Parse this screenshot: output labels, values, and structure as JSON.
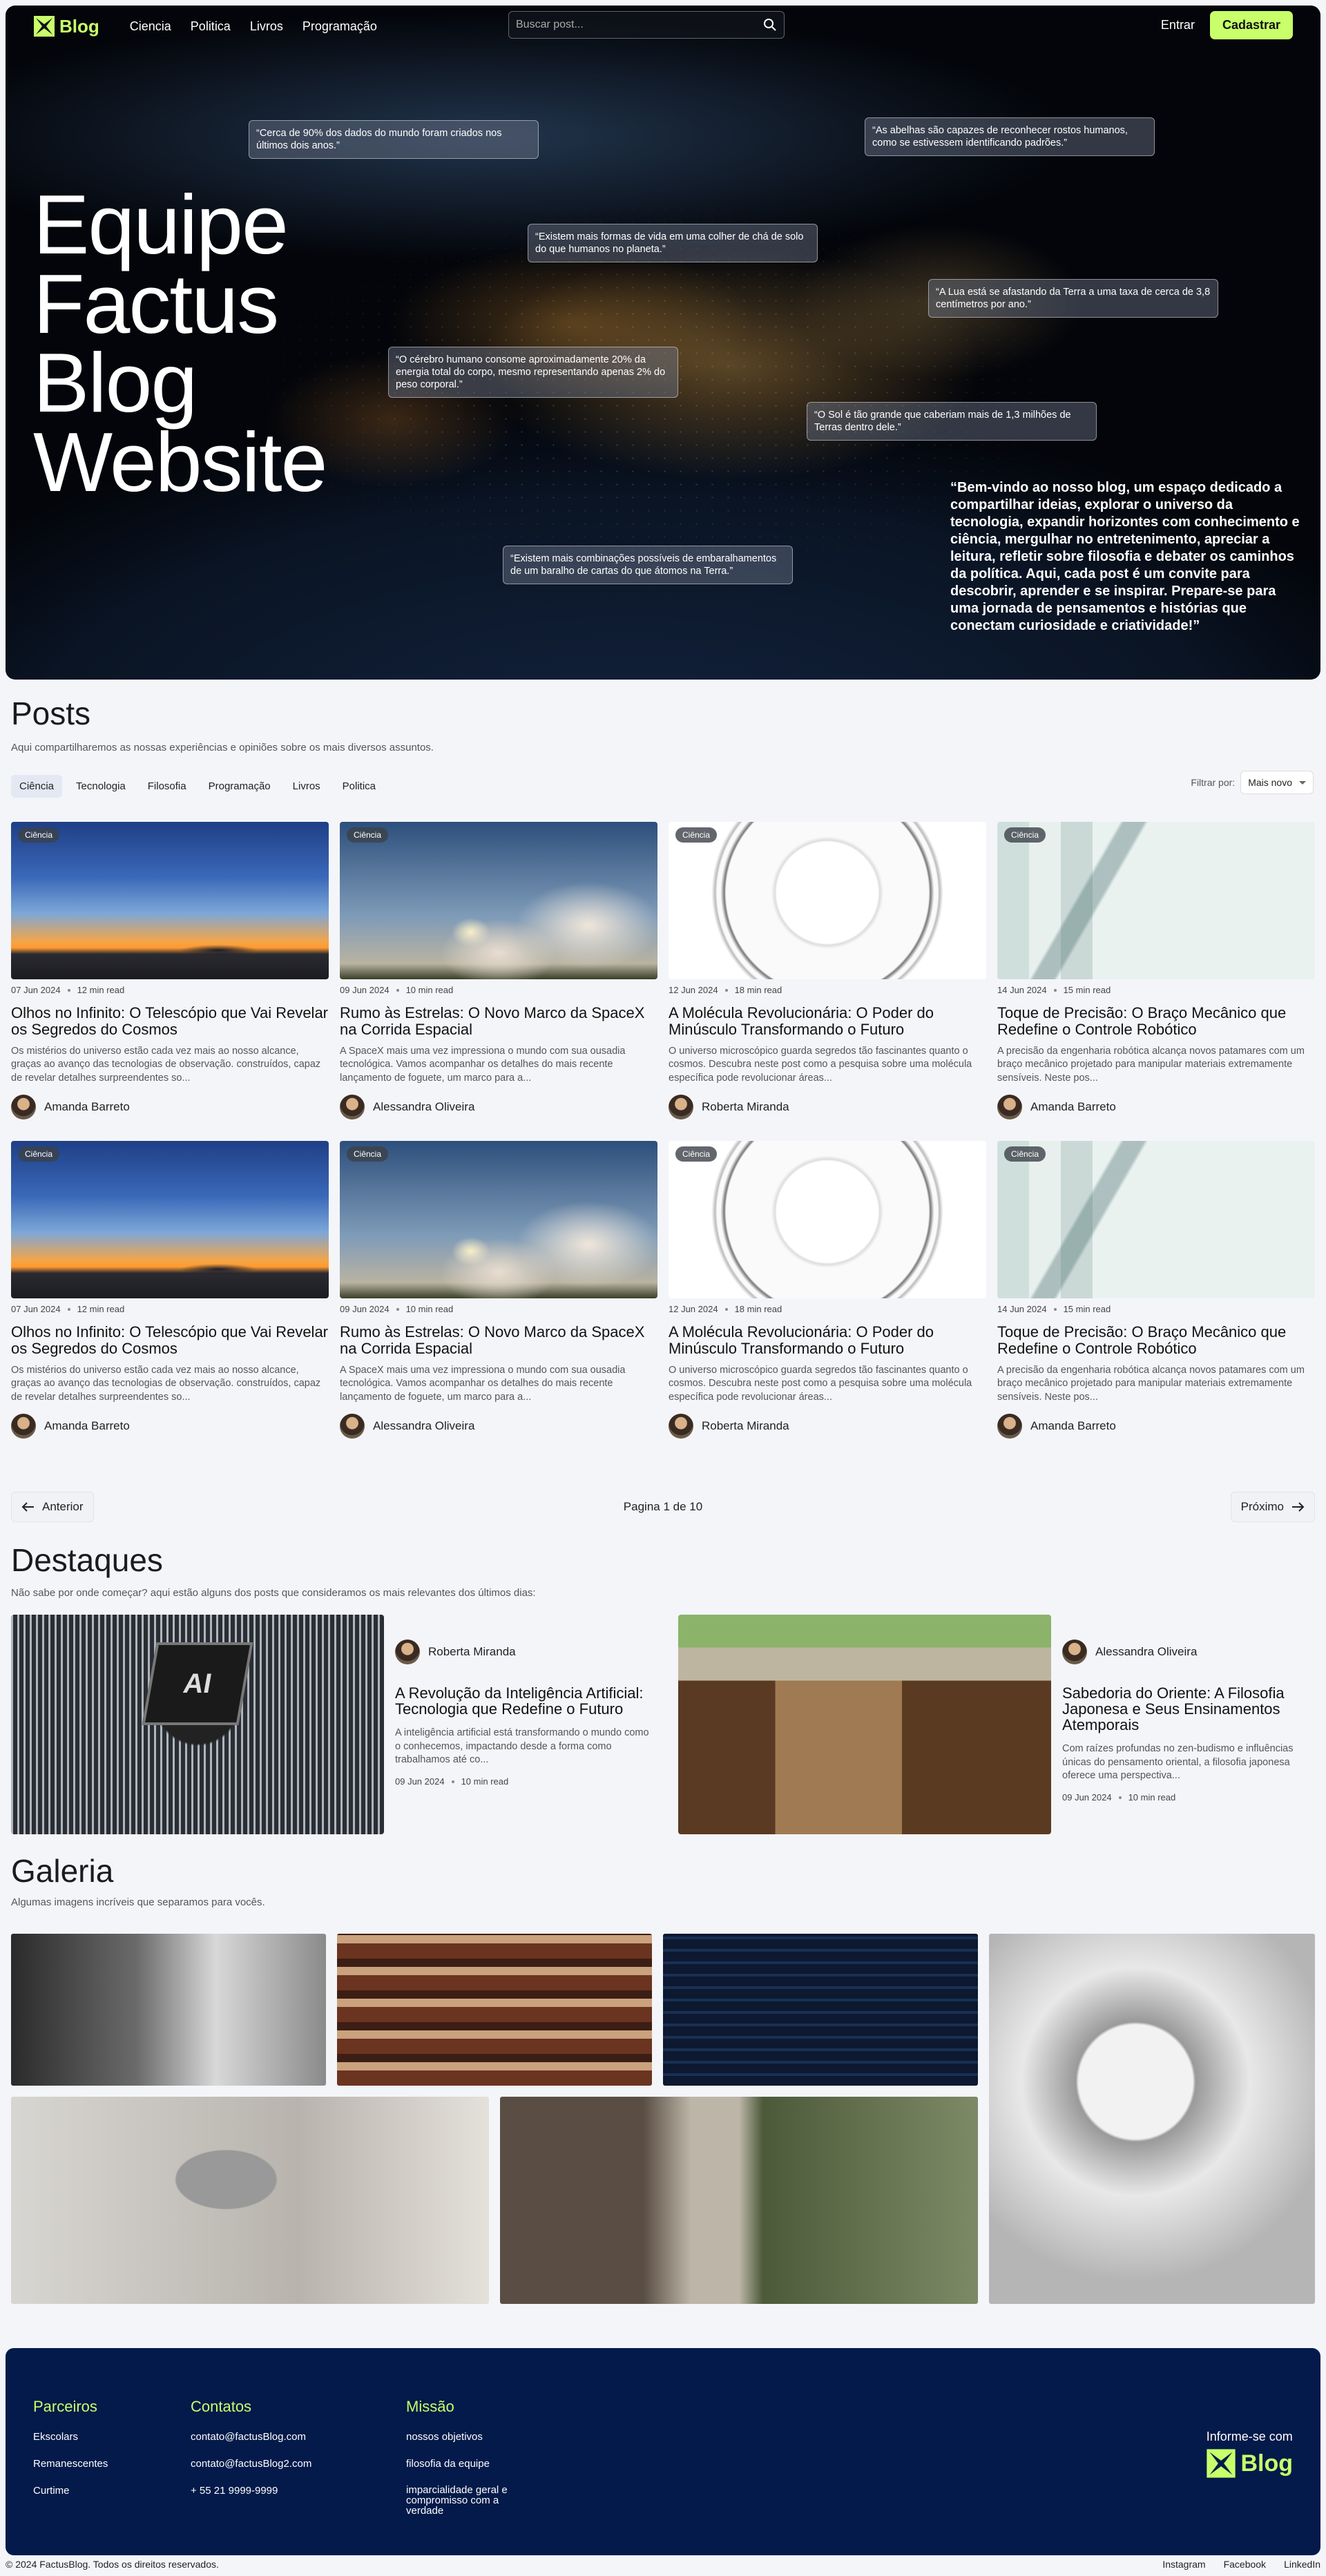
{
  "nav": {
    "logo": "Blog",
    "links": [
      "Ciencia",
      "Politica",
      "Livros",
      "Programação"
    ],
    "search_placeholder": "Buscar post...",
    "login": "Entrar",
    "signup": "Cadastrar"
  },
  "hero": {
    "title_lines": [
      "Equipe",
      "Factus",
      "Blog",
      "Website"
    ],
    "quotes": [
      "“Cerca de 90% dos dados do mundo foram criados nos últimos dois anos.”",
      "“As abelhas são capazes de reconhecer rostos humanos, como se estivessem identificando padrões.”",
      "“Existem mais formas de vida em uma colher de chá de solo do que humanos no planeta.”",
      "“A Lua está se afastando da Terra a uma taxa de cerca de 3,8 centímetros por ano.”",
      "“O cérebro humano consome aproximadamente 20% da energia total do corpo, mesmo representando apenas 2% do peso corporal.”",
      "“O Sol é tão grande que caberiam mais de 1,3 milhões de Terras dentro dele.”",
      "“Existem mais combinações possíveis de embaralhamentos de um baralho de cartas do que átomos na Terra.”"
    ],
    "welcome": "“Bem-vindo ao nosso blog, um espaço dedicado a compartilhar ideias, explorar o universo da tecnologia, expandir horizontes com conhecimento e ciência, mergulhar no entretenimento, apreciar a leitura, refletir sobre filosofia e debater os caminhos da política. Aqui, cada post é um convite para descobrir, aprender e se inspirar. Prepare-se para uma jornada de pensamentos e histórias que conectam curiosidade e criatividade!”"
  },
  "posts": {
    "title": "Posts",
    "subtitle": "Aqui compartilharemos as nossas experiências e opiniões sobre os mais diversos assuntos.",
    "categories": [
      "Ciência",
      "Tecnologia",
      "Filosofia",
      "Programação",
      "Livros",
      "Politica"
    ],
    "filter_label": "Filtrar por:",
    "filter_value": "Mais novo",
    "cards": [
      {
        "badge": "Ciência",
        "date": "07 Jun 2024",
        "read": "12 min read",
        "title": "Olhos no Infinito: O Telescópio que Vai Revelar os Segredos do Cosmos",
        "excerpt": "Os mistérios do universo estão cada vez mais ao nosso alcance, graças ao avanço das tecnologias de observação. construídos, capaz de revelar detalhes surpreendentes so...",
        "author": "Amanda Barreto",
        "img": "i-dish"
      },
      {
        "badge": "Ciência",
        "date": "09 Jun 2024",
        "read": "10 min read",
        "title": "Rumo às Estrelas: O Novo Marco da SpaceX na Corrida Espacial",
        "excerpt": "A SpaceX mais uma vez impressiona o mundo com sua ousadia tecnológica. Vamos acompanhar os detalhes do mais recente lançamento de foguete, um marco para a...",
        "author": "Alessandra Oliveira",
        "img": "i-rocket"
      },
      {
        "badge": "Ciência",
        "date": "12 Jun 2024",
        "read": "18 min read",
        "title": "A Molécula Revolucionária: O Poder do Minúsculo Transformando o Futuro",
        "excerpt": "O universo microscópico guarda segredos tão fascinantes quanto o cosmos. Descubra neste post como a pesquisa sobre uma molécula específica pode revolucionar áreas...",
        "author": "Roberta Miranda",
        "img": "i-dropbowl"
      },
      {
        "badge": "Ciência",
        "date": "14 Jun 2024",
        "read": "15 min read",
        "title": "Toque de Precisão: O Braço Mecânico que Redefine o Controle Robótico",
        "excerpt": "A precisão da engenharia robótica alcança novos patamares com um braço mecânico projetado para manipular materiais extremamente sensíveis. Neste pos...",
        "author": "Amanda Barreto",
        "img": "i-robot"
      },
      {
        "badge": "Ciência",
        "date": "07 Jun 2024",
        "read": "12 min read",
        "title": "Olhos no Infinito: O Telescópio que Vai Revelar os Segredos do Cosmos",
        "excerpt": "Os mistérios do universo estão cada vez mais ao nosso alcance, graças ao avanço das tecnologias de observação. construídos, capaz de revelar detalhes surpreendentes so...",
        "author": "Amanda Barreto",
        "img": "i-dish"
      },
      {
        "badge": "Ciência",
        "date": "09 Jun 2024",
        "read": "10 min read",
        "title": "Rumo às Estrelas: O Novo Marco da SpaceX na Corrida Espacial",
        "excerpt": "A SpaceX mais uma vez impressiona o mundo com sua ousadia tecnológica. Vamos acompanhar os detalhes do mais recente lançamento de foguete, um marco para a...",
        "author": "Alessandra Oliveira",
        "img": "i-rocket"
      },
      {
        "badge": "Ciência",
        "date": "12 Jun 2024",
        "read": "18 min read",
        "title": "A Molécula Revolucionária: O Poder do Minúsculo Transformando o Futuro",
        "excerpt": "O universo microscópico guarda segredos tão fascinantes quanto o cosmos. Descubra neste post como a pesquisa sobre uma molécula específica pode revolucionar áreas...",
        "author": "Roberta Miranda",
        "img": "i-dropbowl"
      },
      {
        "badge": "Ciência",
        "date": "14 Jun 2024",
        "read": "15 min read",
        "title": "Toque de Precisão: O Braço Mecânico que Redefine o Controle Robótico",
        "excerpt": "A precisão da engenharia robótica alcança novos patamares com um braço mecânico projetado para manipular materiais extremamente sensíveis. Neste pos...",
        "author": "Amanda Barreto",
        "img": "i-robot"
      }
    ]
  },
  "pager": {
    "prev": "Anterior",
    "page": "Pagina 1 de 10",
    "next": "Próximo"
  },
  "highlights": {
    "title": "Destaques",
    "subtitle": "Não sabe por onde começar? aqui estão alguns dos posts que consideramos os mais relevantes dos últimos dias:",
    "items": [
      {
        "author": "Roberta Miranda",
        "title": "A Revolução da Inteligência Artificial: Tecnologia que Redefine o Futuro",
        "excerpt": "A inteligência artificial está transformando o mundo como o conhecemos, impactando desde a forma como trabalhamos até co...",
        "date": "09 Jun 2024",
        "read": "10 min read",
        "img": "i-chip"
      },
      {
        "author": "Alessandra Oliveira",
        "title": "Sabedoria do Oriente: A Filosofia Japonesa e Seus Ensinamentos Atemporais",
        "excerpt": "Com raízes profundas no zen-budismo e influências únicas do pensamento oriental, a filosofia japonesa oferece uma perspectiva...",
        "date": "09 Jun 2024",
        "read": "10 min read",
        "img": "i-kyoto"
      }
    ]
  },
  "gallery": {
    "title": "Galeria",
    "subtitle": "Algumas imagens incríveis que separamos para vocês."
  },
  "footer": {
    "partners_title": "Parceiros",
    "partners": [
      "Ekscolars",
      "Remanescentes",
      "Curtime"
    ],
    "contacts_title": "Contatos",
    "contacts": [
      "contato@factusBlog.com",
      "contato@factusBlog2.com",
      "+ 55 21 9999-9999"
    ],
    "mission_title": "Missão",
    "mission": [
      "nossos objetivos",
      "filosofia da equipe",
      "imparcialidade geral e compromisso com a verdade"
    ],
    "inform": "Informe-se com",
    "logo": "Blog",
    "copyright": "© 2024 FactusBlog. Todos os direitos reservados.",
    "social": [
      "Instagram",
      "Facebook",
      "LinkedIn"
    ]
  },
  "colors": {
    "accent": "#c8ff6a",
    "footer_bg": "#031a4a"
  }
}
